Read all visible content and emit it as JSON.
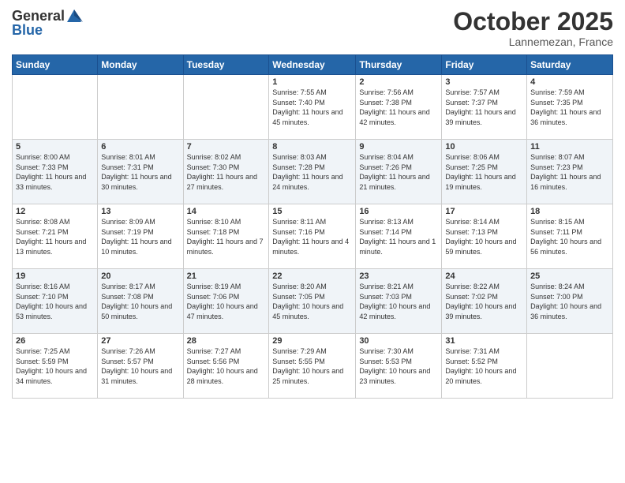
{
  "header": {
    "logo_line1": "General",
    "logo_line2": "Blue",
    "month": "October 2025",
    "location": "Lannemezan, France"
  },
  "weekdays": [
    "Sunday",
    "Monday",
    "Tuesday",
    "Wednesday",
    "Thursday",
    "Friday",
    "Saturday"
  ],
  "weeks": [
    [
      {
        "day": "",
        "sunrise": "",
        "sunset": "",
        "daylight": ""
      },
      {
        "day": "",
        "sunrise": "",
        "sunset": "",
        "daylight": ""
      },
      {
        "day": "",
        "sunrise": "",
        "sunset": "",
        "daylight": ""
      },
      {
        "day": "1",
        "sunrise": "Sunrise: 7:55 AM",
        "sunset": "Sunset: 7:40 PM",
        "daylight": "Daylight: 11 hours and 45 minutes."
      },
      {
        "day": "2",
        "sunrise": "Sunrise: 7:56 AM",
        "sunset": "Sunset: 7:38 PM",
        "daylight": "Daylight: 11 hours and 42 minutes."
      },
      {
        "day": "3",
        "sunrise": "Sunrise: 7:57 AM",
        "sunset": "Sunset: 7:37 PM",
        "daylight": "Daylight: 11 hours and 39 minutes."
      },
      {
        "day": "4",
        "sunrise": "Sunrise: 7:59 AM",
        "sunset": "Sunset: 7:35 PM",
        "daylight": "Daylight: 11 hours and 36 minutes."
      }
    ],
    [
      {
        "day": "5",
        "sunrise": "Sunrise: 8:00 AM",
        "sunset": "Sunset: 7:33 PM",
        "daylight": "Daylight: 11 hours and 33 minutes."
      },
      {
        "day": "6",
        "sunrise": "Sunrise: 8:01 AM",
        "sunset": "Sunset: 7:31 PM",
        "daylight": "Daylight: 11 hours and 30 minutes."
      },
      {
        "day": "7",
        "sunrise": "Sunrise: 8:02 AM",
        "sunset": "Sunset: 7:30 PM",
        "daylight": "Daylight: 11 hours and 27 minutes."
      },
      {
        "day": "8",
        "sunrise": "Sunrise: 8:03 AM",
        "sunset": "Sunset: 7:28 PM",
        "daylight": "Daylight: 11 hours and 24 minutes."
      },
      {
        "day": "9",
        "sunrise": "Sunrise: 8:04 AM",
        "sunset": "Sunset: 7:26 PM",
        "daylight": "Daylight: 11 hours and 21 minutes."
      },
      {
        "day": "10",
        "sunrise": "Sunrise: 8:06 AM",
        "sunset": "Sunset: 7:25 PM",
        "daylight": "Daylight: 11 hours and 19 minutes."
      },
      {
        "day": "11",
        "sunrise": "Sunrise: 8:07 AM",
        "sunset": "Sunset: 7:23 PM",
        "daylight": "Daylight: 11 hours and 16 minutes."
      }
    ],
    [
      {
        "day": "12",
        "sunrise": "Sunrise: 8:08 AM",
        "sunset": "Sunset: 7:21 PM",
        "daylight": "Daylight: 11 hours and 13 minutes."
      },
      {
        "day": "13",
        "sunrise": "Sunrise: 8:09 AM",
        "sunset": "Sunset: 7:19 PM",
        "daylight": "Daylight: 11 hours and 10 minutes."
      },
      {
        "day": "14",
        "sunrise": "Sunrise: 8:10 AM",
        "sunset": "Sunset: 7:18 PM",
        "daylight": "Daylight: 11 hours and 7 minutes."
      },
      {
        "day": "15",
        "sunrise": "Sunrise: 8:11 AM",
        "sunset": "Sunset: 7:16 PM",
        "daylight": "Daylight: 11 hours and 4 minutes."
      },
      {
        "day": "16",
        "sunrise": "Sunrise: 8:13 AM",
        "sunset": "Sunset: 7:14 PM",
        "daylight": "Daylight: 11 hours and 1 minute."
      },
      {
        "day": "17",
        "sunrise": "Sunrise: 8:14 AM",
        "sunset": "Sunset: 7:13 PM",
        "daylight": "Daylight: 10 hours and 59 minutes."
      },
      {
        "day": "18",
        "sunrise": "Sunrise: 8:15 AM",
        "sunset": "Sunset: 7:11 PM",
        "daylight": "Daylight: 10 hours and 56 minutes."
      }
    ],
    [
      {
        "day": "19",
        "sunrise": "Sunrise: 8:16 AM",
        "sunset": "Sunset: 7:10 PM",
        "daylight": "Daylight: 10 hours and 53 minutes."
      },
      {
        "day": "20",
        "sunrise": "Sunrise: 8:17 AM",
        "sunset": "Sunset: 7:08 PM",
        "daylight": "Daylight: 10 hours and 50 minutes."
      },
      {
        "day": "21",
        "sunrise": "Sunrise: 8:19 AM",
        "sunset": "Sunset: 7:06 PM",
        "daylight": "Daylight: 10 hours and 47 minutes."
      },
      {
        "day": "22",
        "sunrise": "Sunrise: 8:20 AM",
        "sunset": "Sunset: 7:05 PM",
        "daylight": "Daylight: 10 hours and 45 minutes."
      },
      {
        "day": "23",
        "sunrise": "Sunrise: 8:21 AM",
        "sunset": "Sunset: 7:03 PM",
        "daylight": "Daylight: 10 hours and 42 minutes."
      },
      {
        "day": "24",
        "sunrise": "Sunrise: 8:22 AM",
        "sunset": "Sunset: 7:02 PM",
        "daylight": "Daylight: 10 hours and 39 minutes."
      },
      {
        "day": "25",
        "sunrise": "Sunrise: 8:24 AM",
        "sunset": "Sunset: 7:00 PM",
        "daylight": "Daylight: 10 hours and 36 minutes."
      }
    ],
    [
      {
        "day": "26",
        "sunrise": "Sunrise: 7:25 AM",
        "sunset": "Sunset: 5:59 PM",
        "daylight": "Daylight: 10 hours and 34 minutes."
      },
      {
        "day": "27",
        "sunrise": "Sunrise: 7:26 AM",
        "sunset": "Sunset: 5:57 PM",
        "daylight": "Daylight: 10 hours and 31 minutes."
      },
      {
        "day": "28",
        "sunrise": "Sunrise: 7:27 AM",
        "sunset": "Sunset: 5:56 PM",
        "daylight": "Daylight: 10 hours and 28 minutes."
      },
      {
        "day": "29",
        "sunrise": "Sunrise: 7:29 AM",
        "sunset": "Sunset: 5:55 PM",
        "daylight": "Daylight: 10 hours and 25 minutes."
      },
      {
        "day": "30",
        "sunrise": "Sunrise: 7:30 AM",
        "sunset": "Sunset: 5:53 PM",
        "daylight": "Daylight: 10 hours and 23 minutes."
      },
      {
        "day": "31",
        "sunrise": "Sunrise: 7:31 AM",
        "sunset": "Sunset: 5:52 PM",
        "daylight": "Daylight: 10 hours and 20 minutes."
      },
      {
        "day": "",
        "sunrise": "",
        "sunset": "",
        "daylight": ""
      }
    ]
  ]
}
